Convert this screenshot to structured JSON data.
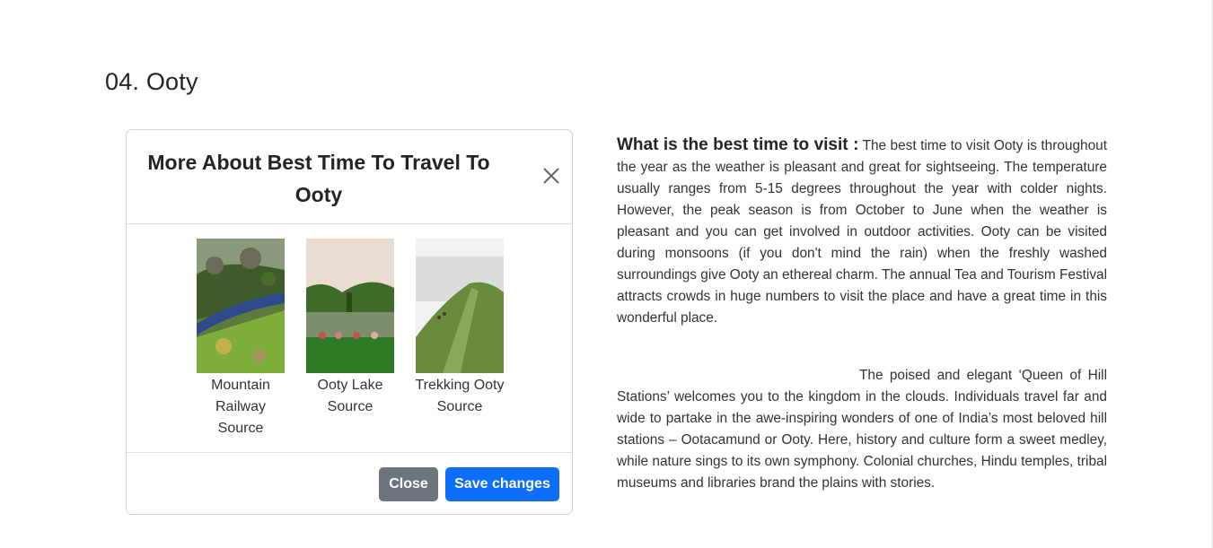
{
  "section": {
    "title": "04. Ooty"
  },
  "modal": {
    "title": "More About Best Time To Travel To Ooty",
    "close_icon": "close-icon",
    "images": [
      {
        "caption": "Mountain Railway Source",
        "icon": "mountain-railway-photo"
      },
      {
        "caption": "Ooty Lake Source",
        "icon": "ooty-lake-photo"
      },
      {
        "caption": "Trekking Ooty Source",
        "icon": "trekking-photo"
      }
    ],
    "buttons": {
      "close": "Close",
      "save": "Save changes"
    },
    "colors": {
      "close": "#6c757d",
      "save": "#0d6efd"
    }
  },
  "article": {
    "question": "What is the best time to visit :",
    "paragraph1": "The best time to visit Ooty is throughout the year as the weather is pleasant and great for sightseeing. The temperature usually ranges from 5-15 degrees throughout the year with colder nights. However, the peak season is from October to June when the weather is pleasant and you can get involved in outdoor activities. Ooty can be visited during monsoons (if you don't mind the rain) when the freshly washed surroundings give Ooty an ethereal charm. The annual Tea and Tourism Festival attracts crowds in huge numbers to visit the place and have a great time in this wonderful place.",
    "paragraph2": "The poised and elegant ‘Queen of Hill Stations’ welcomes you to the kingdom in the clouds. Individuals travel far and wide to partake in the awe-inspiring wonders of one of India’s most beloved hill stations – Ootacamund or Ooty. Here, history and culture form a sweet medley, while nature sings to its own symphony. Colonial churches, Hindu temples, tribal museums and libraries brand the plains with stories."
  }
}
